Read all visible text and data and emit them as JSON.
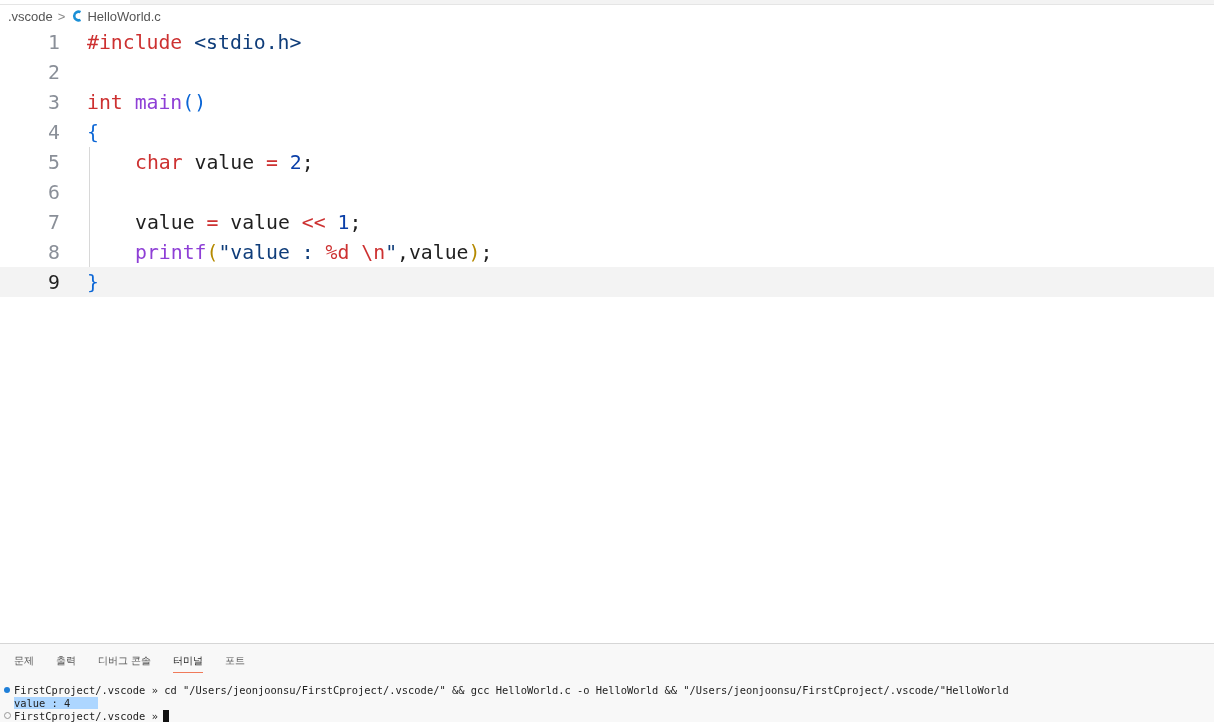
{
  "breadcrumb": {
    "folder": ".vscode",
    "separator": ">",
    "file": "HelloWorld.c"
  },
  "editor": {
    "lines": [
      {
        "number": "1",
        "current": false,
        "indented": false,
        "tokens": [
          {
            "kind": "keyword",
            "text": "#include"
          },
          {
            "kind": "string",
            "text": " <stdio.h>"
          }
        ]
      },
      {
        "number": "2",
        "current": false,
        "indented": false
      },
      {
        "number": "3",
        "current": false,
        "indented": false,
        "tokens": [
          {
            "kind": "keyword",
            "text": "int"
          },
          {
            "kind": "function",
            "text": " main"
          },
          {
            "kind": "bracket",
            "text": "()"
          }
        ]
      },
      {
        "number": "4",
        "current": false,
        "indented": false,
        "tokens": [
          {
            "kind": "bracket",
            "text": "{"
          }
        ]
      },
      {
        "number": "5",
        "current": false,
        "indented": true,
        "tokens": [
          {
            "kind": "keyword",
            "text": "char"
          },
          {
            "kind": "plain",
            "text": " value "
          },
          {
            "kind": "keyword",
            "text": "="
          },
          {
            "kind": "number",
            "text": " 2"
          },
          {
            "kind": "plain",
            "text": ";"
          }
        ]
      },
      {
        "number": "6",
        "current": false,
        "indented": true
      },
      {
        "number": "7",
        "current": false,
        "indented": true,
        "tokens": [
          {
            "kind": "plain",
            "text": "value "
          },
          {
            "kind": "keyword",
            "text": "="
          },
          {
            "kind": "plain",
            "text": " value "
          },
          {
            "kind": "keyword",
            "text": "<<"
          },
          {
            "kind": "number",
            "text": " 1"
          },
          {
            "kind": "plain",
            "text": ";"
          }
        ]
      },
      {
        "number": "8",
        "current": false,
        "indented": true,
        "tokens": [
          {
            "kind": "function",
            "text": "printf"
          },
          {
            "kind": "paren",
            "text": "("
          },
          {
            "kind": "string",
            "text": "\"value : "
          },
          {
            "kind": "keyword",
            "text": "%d \\n"
          },
          {
            "kind": "string",
            "text": "\""
          },
          {
            "kind": "plain",
            "text": ",value"
          },
          {
            "kind": "paren",
            "text": ")"
          },
          {
            "kind": "plain",
            "text": ";"
          }
        ]
      },
      {
        "number": "9",
        "current": true,
        "indented": false,
        "tokens": [
          {
            "kind": "bracket",
            "text": "}"
          }
        ]
      }
    ]
  },
  "panel": {
    "tabs": [
      {
        "label": "문제",
        "selected": false
      },
      {
        "label": "출력",
        "selected": false
      },
      {
        "label": "디버그 콘솔",
        "selected": false
      },
      {
        "label": "터미널",
        "selected": true
      },
      {
        "label": "포트",
        "selected": false
      }
    ],
    "terminal": [
      {
        "kind": "command",
        "text": "FirstCproject/.vscode » cd \"/Users/jeonjoonsu/FirstCproject/.vscode/\" && gcc HelloWorld.c -o HelloWorld && \"/Users/jeonjoonsu/FirstCproject/.vscode/\"HelloWorld"
      },
      {
        "kind": "output",
        "text": "value : 4"
      },
      {
        "kind": "prompt",
        "text": "FirstCproject/.vscode »"
      }
    ]
  }
}
